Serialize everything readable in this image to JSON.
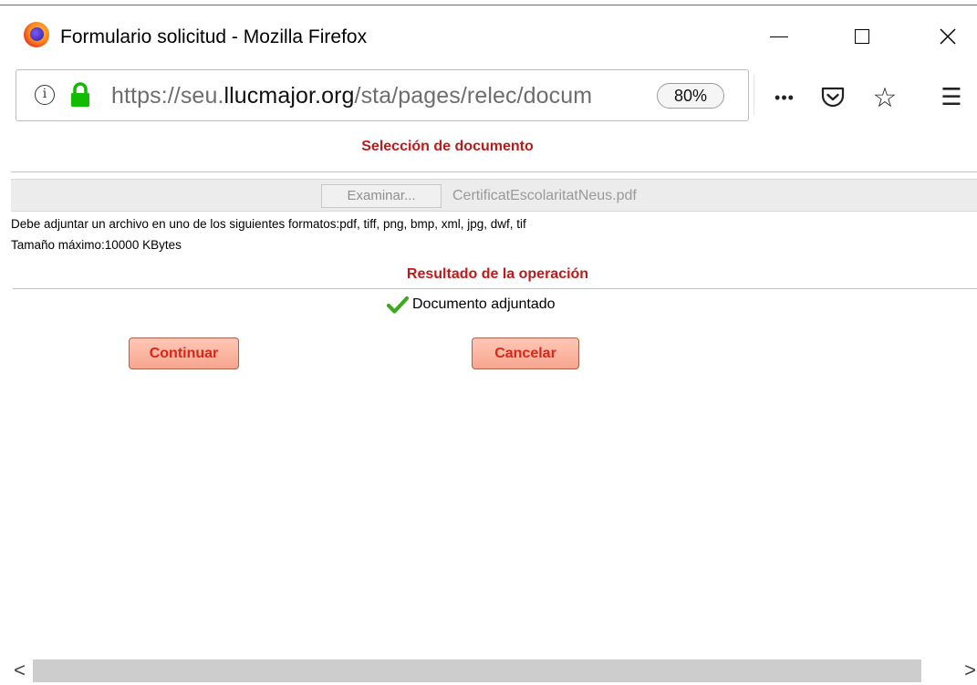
{
  "window": {
    "title": "Formulario solicitud - Mozilla Firefox",
    "close_glyph": "✕",
    "icons": [
      "firefox-logo",
      "minimize-icon",
      "maximize-icon",
      "close-icon"
    ]
  },
  "navbar": {
    "url_prefix": "https://seu.",
    "url_domain": "llucmajor.org",
    "url_path": "/sta/pages/relec/docum",
    "zoom": "80%",
    "info_glyph": "i",
    "more_glyph": "•••",
    "star_glyph": "☆",
    "menu_glyph": "☰",
    "secure_color": "#12bc00",
    "icons": [
      "info-icon",
      "lock-icon",
      "more-icon",
      "pocket-icon",
      "star-icon",
      "menu-icon"
    ]
  },
  "page": {
    "section_title": "Selección de documento",
    "browse_button": "Examinar...",
    "file_name": "CertificatEscolaritatNeus.pdf",
    "formats_note": "Debe adjuntar un archivo en uno de los siguientes formatos:pdf, tiff, png, bmp, xml, jpg, dwf, tif",
    "max_size_note": "Tamaño máximo:10000 KBytes",
    "result_title": "Resultado de la operación",
    "result_message": "Documento adjuntado",
    "continue_button": "Continuar",
    "cancel_button": "Cancelar",
    "accent_color": "#bd1a1a",
    "success_color": "#3caa1e"
  },
  "scrollbar": {
    "left_glyph": "<",
    "right_glyph": ">"
  }
}
